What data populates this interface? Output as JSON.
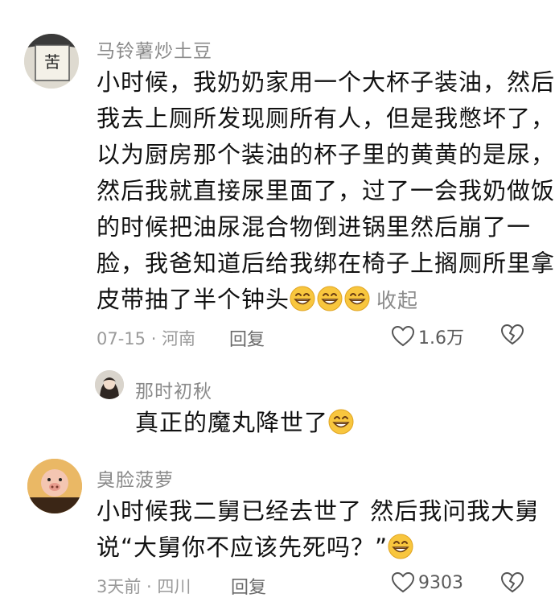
{
  "comments": [
    {
      "username": "马铃薯炒土豆",
      "lines": [
        "小时候，我奶奶家用一个大杯子装油，然后",
        "我去上厕所发现厕所有人，但是我憋坏了，",
        "以为厨房那个装油的杯子里的黄黄的是尿，",
        "然后我就直接尿里面了，过了一会我奶做饭",
        "的时候把油尿混合物倒进锅里然后崩了一",
        "脸，我爸知道后给我绑在椅子上搁厕所里拿",
        "皮带抽了半个钟头"
      ],
      "collapse_label": "收起",
      "meta": "07-15 · 河南",
      "reply_label": "回复",
      "likes": "1.6万"
    },
    {
      "username": "那时初秋",
      "lines": [
        "真正的魔丸降世了"
      ]
    },
    {
      "username": "臭脸菠萝",
      "lines": [
        "小时候我二舅已经去世了 然后我问我大舅",
        "说“大舅你不应该先死吗？”"
      ],
      "meta": "3天前 · 四川",
      "reply_label": "回复",
      "likes": "9303"
    }
  ],
  "icons": {
    "emoji": "grinning-face-icon",
    "like": "heart-outline-icon",
    "dislike": "broken-heart-icon"
  },
  "colors": {
    "emoji_face": "#f7c23b",
    "muted_text": "#8a8a8a"
  }
}
